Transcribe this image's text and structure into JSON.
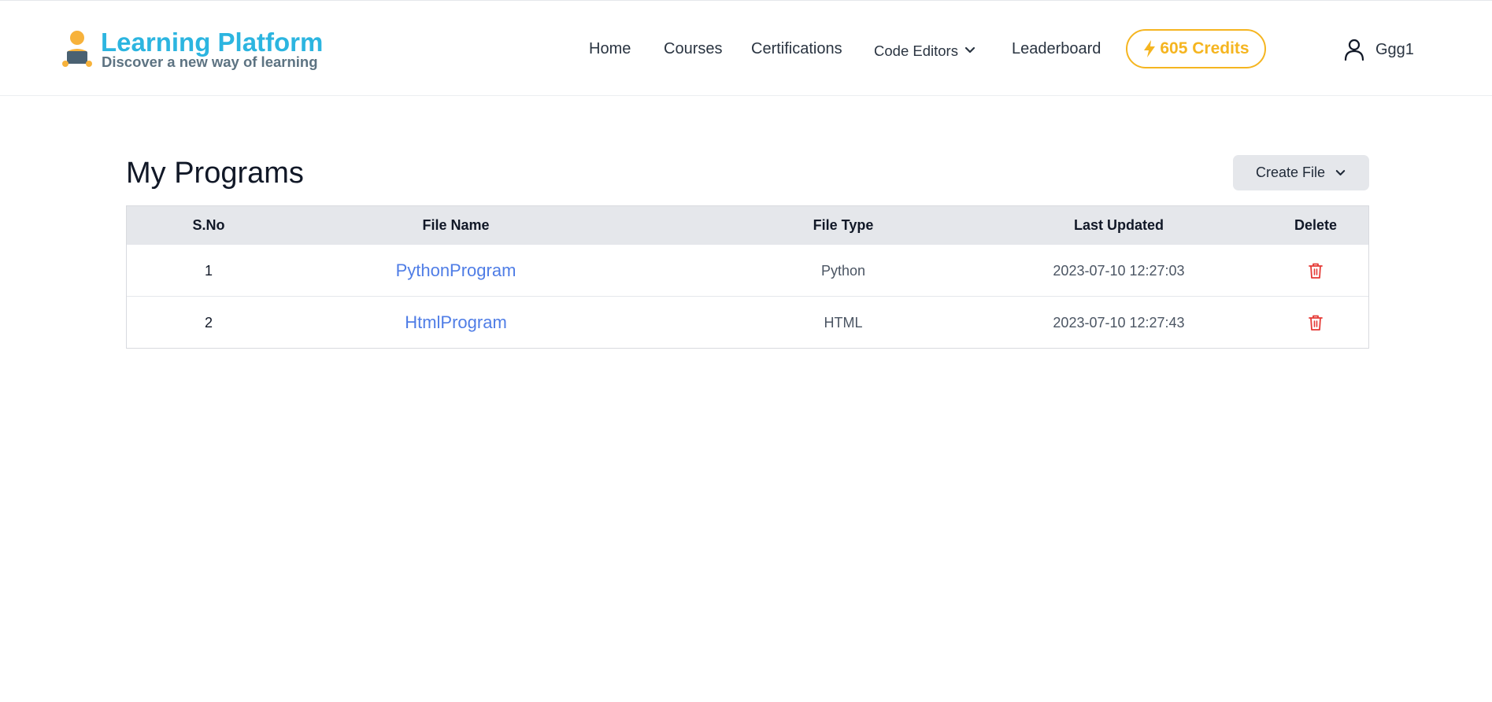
{
  "header": {
    "brand_title": "Learning Platform",
    "brand_subtitle": "Discover a new way of learning",
    "nav": {
      "home": "Home",
      "courses": "Courses",
      "certifications": "Certifications",
      "code_editors": "Code Editors",
      "leaderboard": "Leaderboard"
    },
    "credits_label": "605 Credits",
    "username": "Ggg1"
  },
  "main": {
    "title": "My Programs",
    "create_file_label": "Create File",
    "table": {
      "columns": [
        "S.No",
        "File Name",
        "File Type",
        "Last Updated",
        "Delete"
      ],
      "rows": [
        {
          "sno": "1",
          "file_name": "PythonProgram",
          "file_type": "Python",
          "last_updated": "2023-07-10 12:27:03"
        },
        {
          "sno": "2",
          "file_name": "HtmlProgram",
          "file_type": "HTML",
          "last_updated": "2023-07-10 12:27:43"
        }
      ]
    }
  },
  "icons": {
    "logo": "person-at-laptop-icon",
    "code_editors_dropdown": "chevron-down-icon",
    "credits": "lightning-bolt-icon",
    "user": "user-icon",
    "create_file_dropdown": "chevron-down-icon",
    "delete": "trash-icon"
  },
  "colors": {
    "brand_title": "#2cb5e0",
    "brand_subtitle": "#5d7382",
    "credits": "#f5b520",
    "link": "#4f7de6",
    "delete": "#e53935",
    "table_header_bg": "#e5e7eb"
  }
}
